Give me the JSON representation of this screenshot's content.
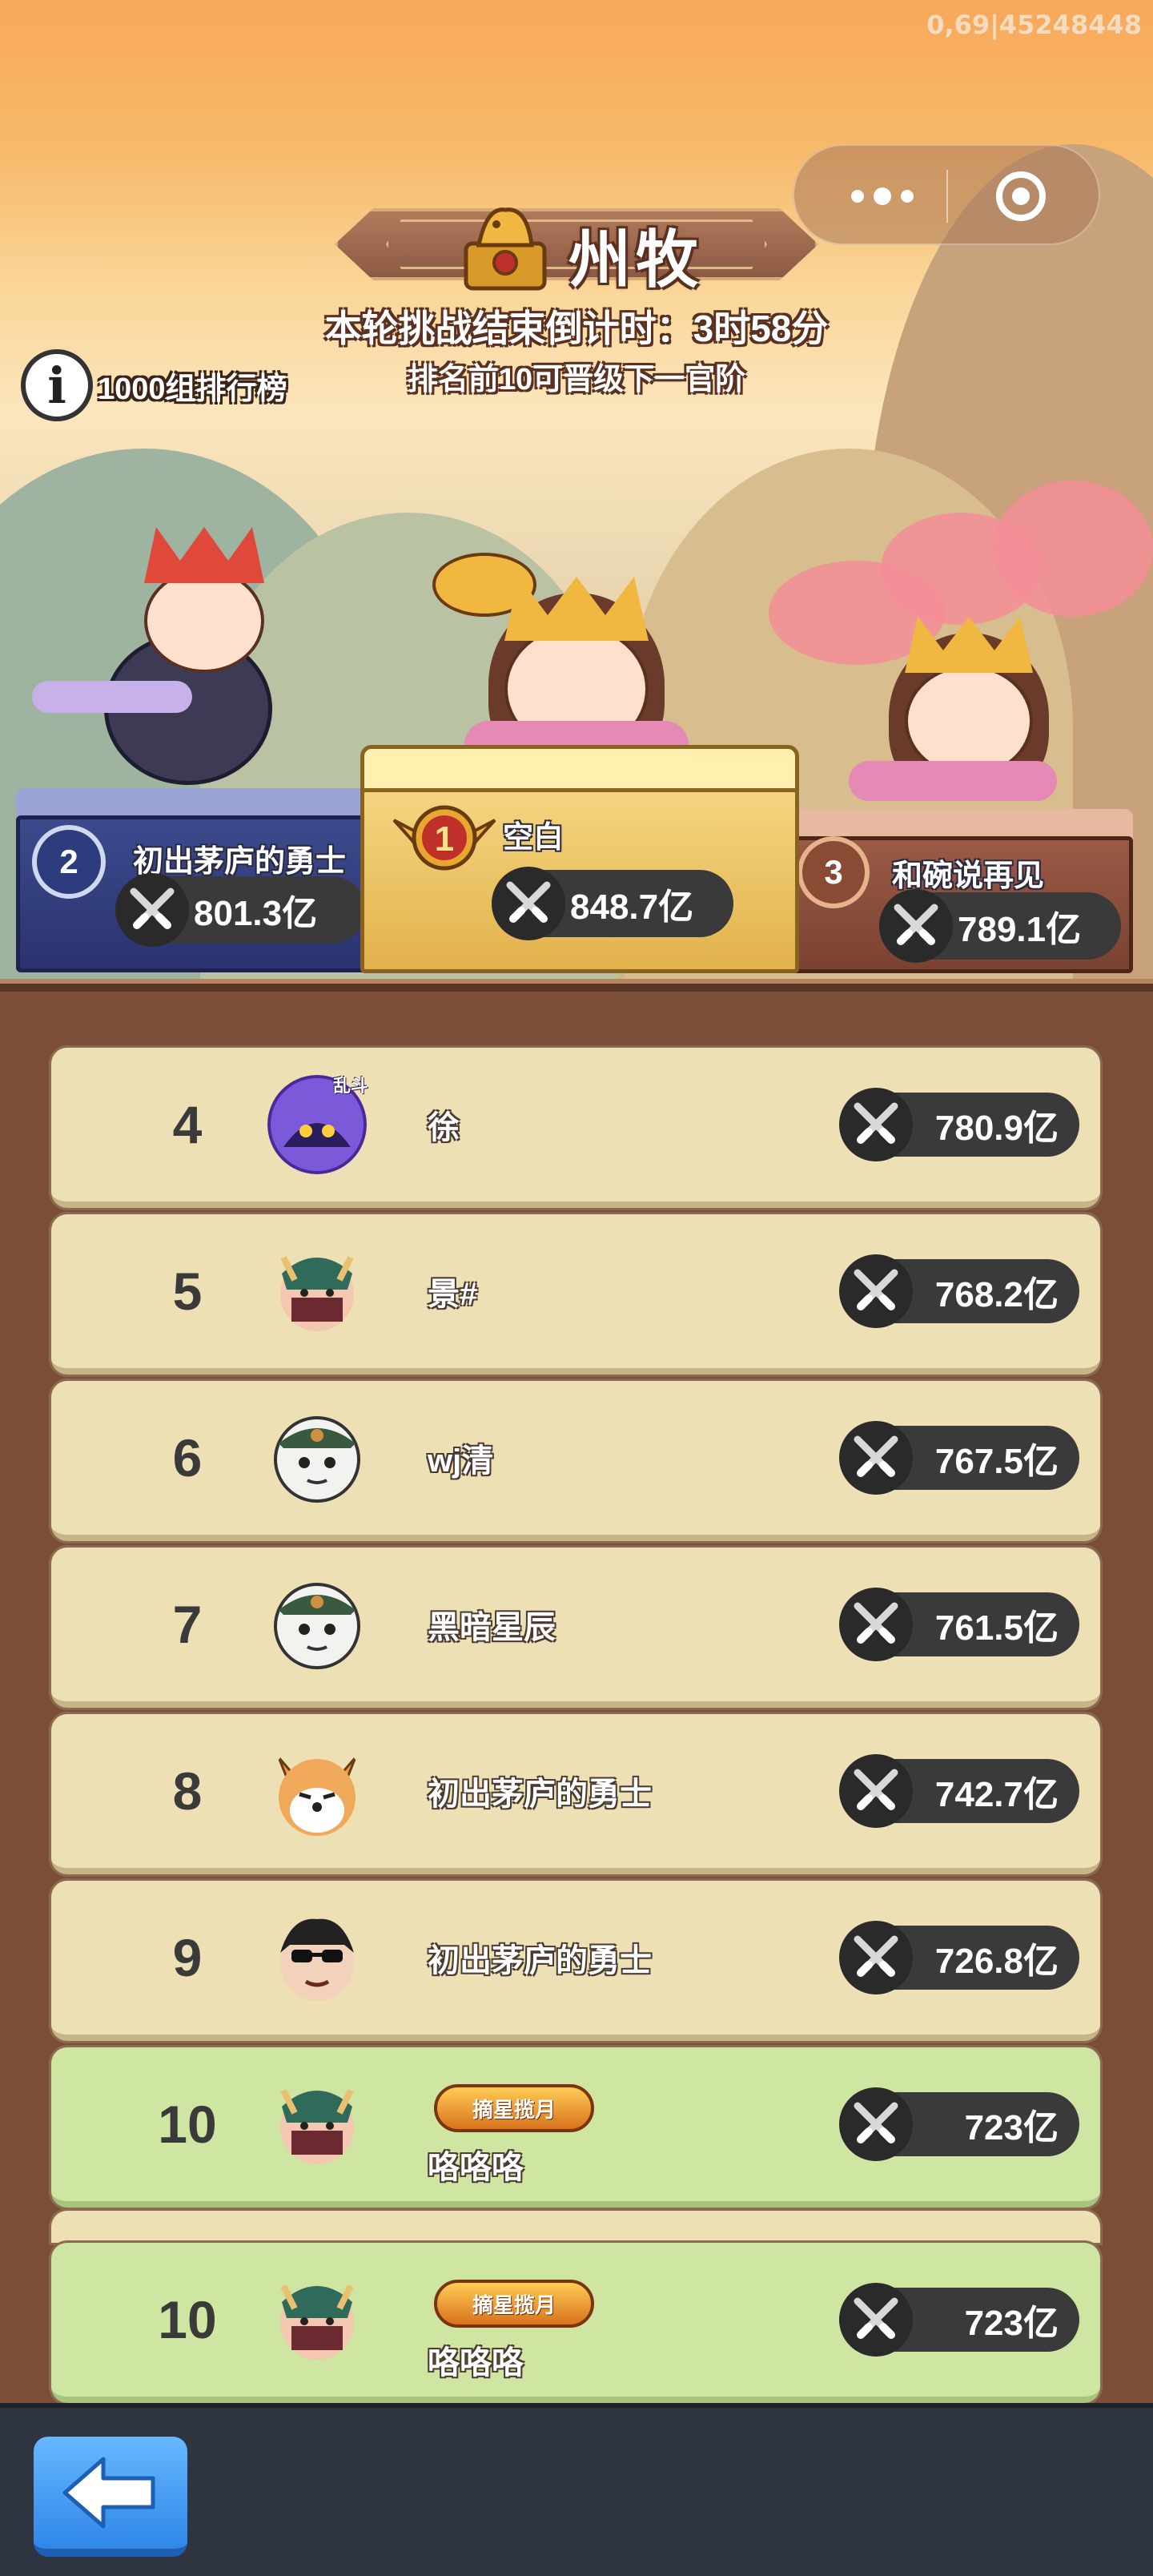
{
  "status": {
    "build_id": "0,69|45248448"
  },
  "capsule": {
    "more_icon": "more-dots-icon",
    "close_icon": "mini-program-close-icon"
  },
  "header": {
    "title": "州牧",
    "countdown": "本轮挑战结束倒计时：3时58分",
    "promotion": "排名前10可晋级下一官阶",
    "info_label": "1000组排行榜",
    "info_icon": "info-icon"
  },
  "podium": {
    "first": {
      "rank": "1",
      "name": "空白",
      "power": "848.7亿"
    },
    "second": {
      "rank": "2",
      "name": "初出茅庐的勇士",
      "power": "801.3亿"
    },
    "third": {
      "rank": "3",
      "name": "和碗说再见",
      "power": "789.1亿"
    }
  },
  "leaderboard": [
    {
      "rank": "4",
      "name": "徐",
      "power": "780.9亿",
      "avatar": "purple-monster-avatar",
      "avatar_tag": "乱斗"
    },
    {
      "rank": "5",
      "name": "景#",
      "power": "768.2亿",
      "avatar": "horned-warrior-avatar"
    },
    {
      "rank": "6",
      "name": "wj清",
      "power": "767.5亿",
      "avatar": "white-hooded-avatar"
    },
    {
      "rank": "7",
      "name": "黑暗星辰",
      "power": "761.5亿",
      "avatar": "white-hooded-avatar"
    },
    {
      "rank": "8",
      "name": "初出茅庐的勇士",
      "power": "742.7亿",
      "avatar": "corgi-avatar"
    },
    {
      "rank": "9",
      "name": "初出茅庐的勇士",
      "power": "726.8亿",
      "avatar": "sunglasses-avatar"
    },
    {
      "rank": "10",
      "name": "咯咯咯",
      "power": "723亿",
      "avatar": "horned-warrior-avatar",
      "title_badge": "摘星揽月"
    }
  ],
  "self_row": {
    "rank": "10",
    "name": "咯咯咯",
    "power": "723亿",
    "avatar": "horned-warrior-avatar",
    "title_badge": "摘星揽月"
  },
  "footer": {
    "back_icon": "back-arrow-icon"
  },
  "colors": {
    "row_bg": "#ede0b5",
    "self_row_bg": "#cfe6a2",
    "frame": "#7a4e37",
    "power_pill": "#3a3a3a",
    "back_button": "#3a95f2"
  }
}
